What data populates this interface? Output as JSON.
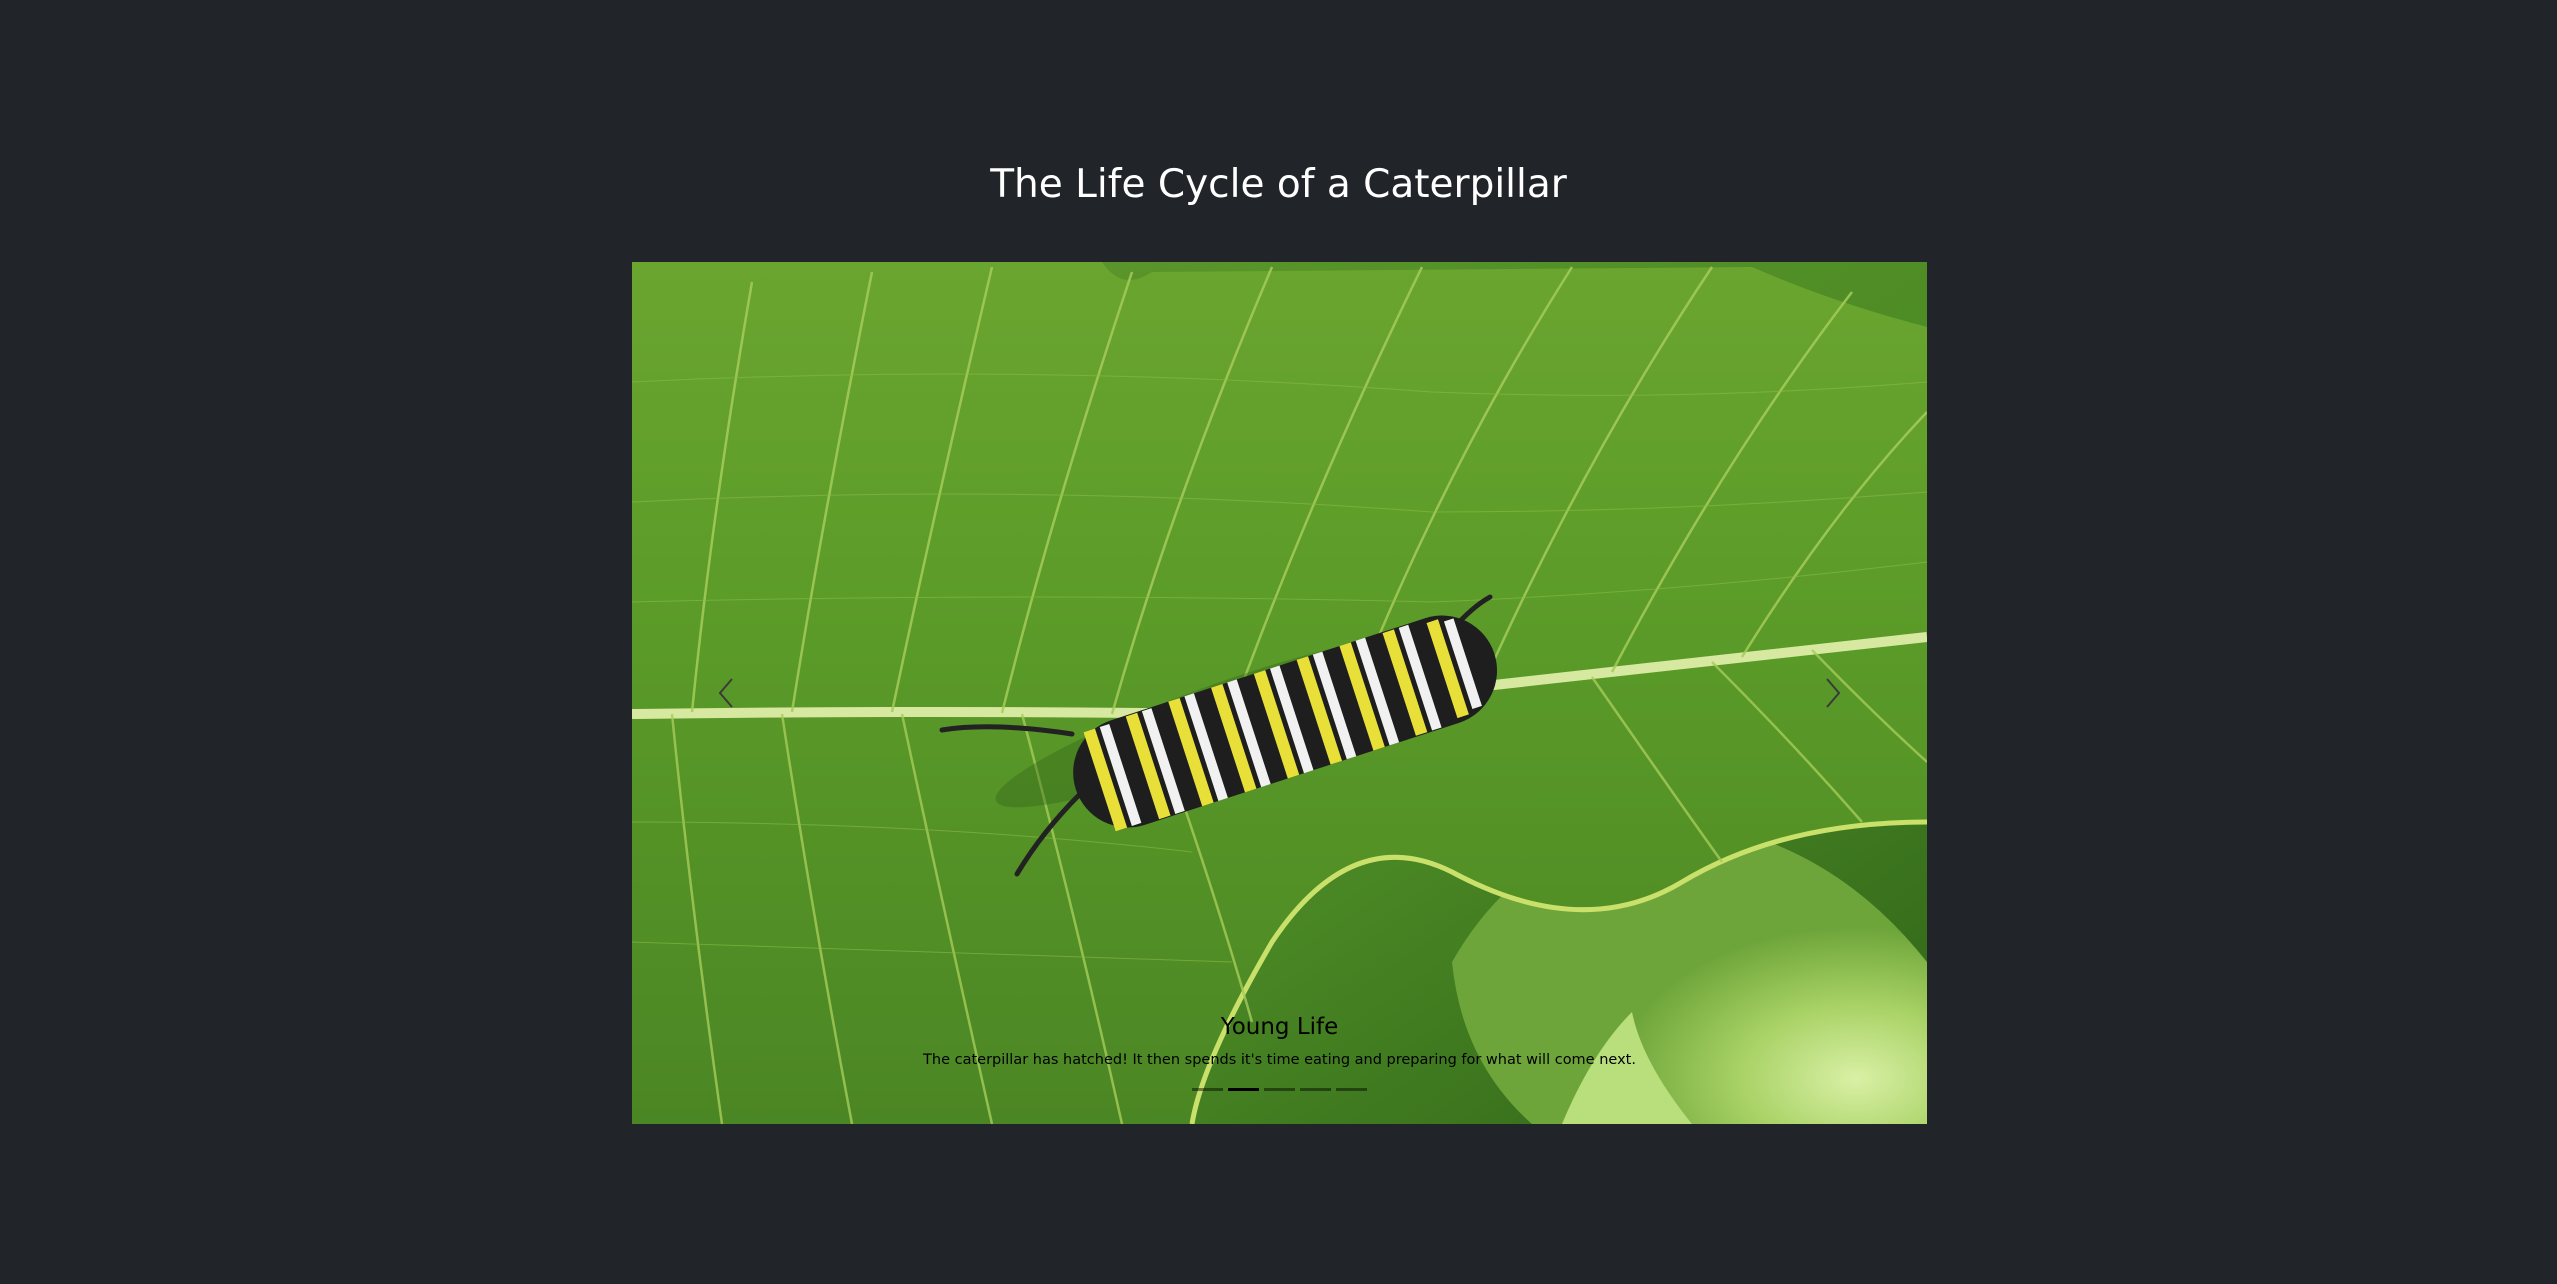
{
  "page": {
    "title": "The Life Cycle of a Caterpillar"
  },
  "carousel": {
    "active_index": 1,
    "slide": {
      "image_subject": "caterpillar-on-milkweed-leaf-photo",
      "caption_title": "Young Life",
      "caption_text": "The caterpillar has hatched! It then spends it's time eating and preparing for what will come next."
    },
    "controls": {
      "prev_icon": "chevron-left-icon",
      "next_icon": "chevron-right-icon"
    },
    "indicator_count": 5
  },
  "colors": {
    "background": "#212429",
    "title": "#ffffff",
    "caption": "#000000"
  }
}
